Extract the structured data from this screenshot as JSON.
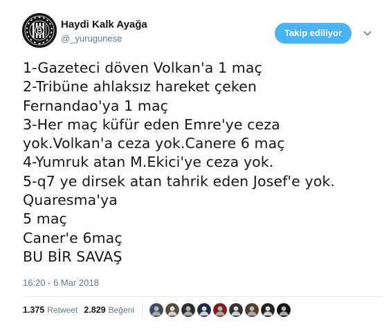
{
  "user": {
    "display_name": "Haydi Kalk Ayağa",
    "handle": "@_yurugunese",
    "avatar_icon": "team-logo-icon",
    "avatar_colors": {
      "background": "#151515",
      "foreground": "#ffffff"
    },
    "avatar_ring_text": "HAYDİ KALK AYAĞA · YÜRÜ GÜNEŞE"
  },
  "follow_button": {
    "label": "Takip ediliyor",
    "color": "#4ab3f4"
  },
  "menu_icon": "chevron-down-icon",
  "tweet": {
    "lines": [
      "1-Gazeteci döven Volkan'a 1 maç",
      "2-Tribüne ahlaksız hareket çeken",
      "Fernandao'ya 1 maç",
      "3-Her maç küfür eden Emre'ye ceza",
      "yok.Volkan'a ceza yok.Canere 6 maç",
      "4-Yumruk atan M.Ekici'ye ceza yok.",
      "5-q7 ye dirsek atan tahrik eden Josef'e yok.",
      "Quaresma'ya",
      "5 maç",
      "Caner'e 6maç",
      "BU BİR SAVAŞ"
    ]
  },
  "timestamp": "16:20 - 6 Mar 2018",
  "stats": {
    "retweets": {
      "count": "1.375",
      "label": "Retweet"
    },
    "likes": {
      "count": "2.829",
      "label": "Beğeni"
    }
  },
  "likers": [
    {
      "icon": "liker-avatar-icon",
      "color": "#3d4a5c"
    },
    {
      "icon": "liker-avatar-icon",
      "color": "#5a4a3a"
    },
    {
      "icon": "liker-avatar-icon",
      "color": "#2b2b2b"
    },
    {
      "icon": "liker-avatar-icon",
      "color": "#1f2a44"
    },
    {
      "icon": "liker-avatar-icon",
      "color": "#7a1f1f"
    },
    {
      "icon": "liker-avatar-icon",
      "color": "#333333"
    },
    {
      "icon": "liker-avatar-icon",
      "color": "#4d3d2d"
    },
    {
      "icon": "liker-avatar-icon",
      "color": "#222222"
    },
    {
      "icon": "liker-avatar-icon",
      "color": "#111111"
    }
  ]
}
